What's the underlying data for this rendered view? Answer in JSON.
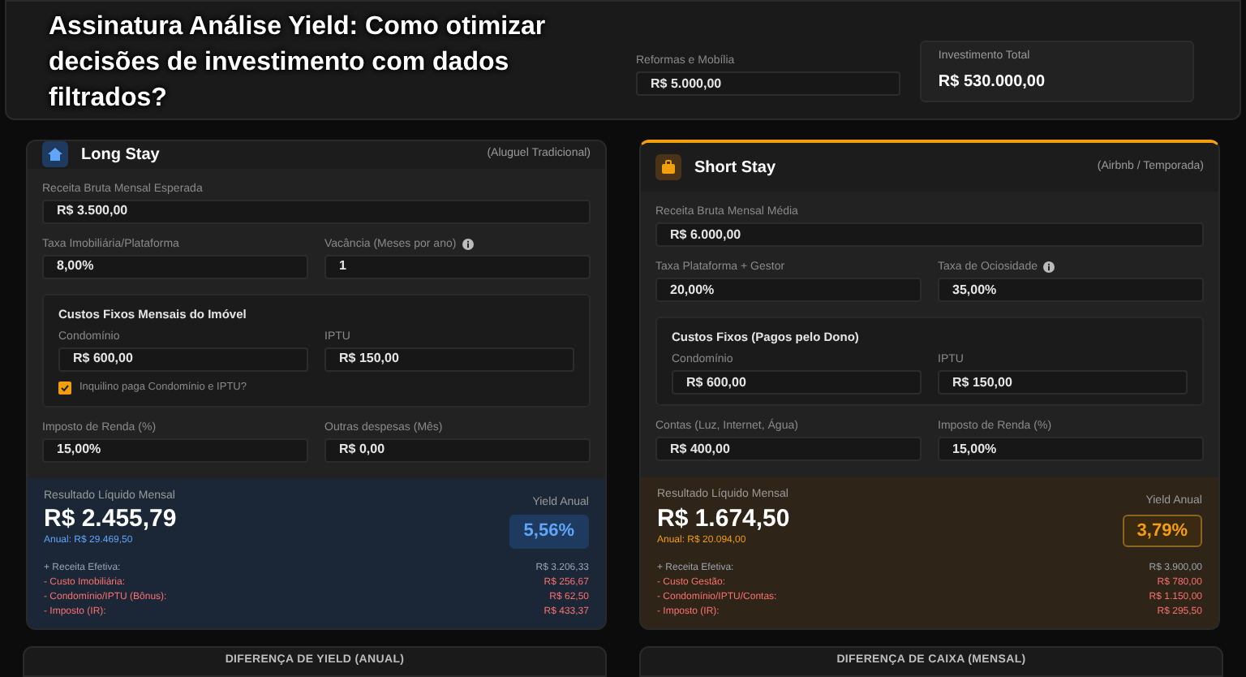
{
  "overlay_title": "Assinatura Análise Yield: Como otimizar decisões de investimento com dados filtrados?",
  "investment": {
    "fields": [
      {
        "label": "Reformas e Mobília",
        "value": "R$ 5.000,00"
      }
    ],
    "total": {
      "label": "Investimento Total",
      "value": "R$ 530.000,00"
    }
  },
  "scenarios": [
    {
      "kind": "long",
      "title": "Long Stay",
      "subtitle": "(Aluguel Tradicional)",
      "revenue": {
        "label": "Receita Bruta Mensal Esperada",
        "value": "R$ 3.500,00"
      },
      "row1": [
        {
          "label": "Taxa Imobiliária/Plataforma",
          "value": "8,00%",
          "info": false
        },
        {
          "label": "Vacância (Meses por ano)",
          "value": "1",
          "info": true
        }
      ],
      "fixed": {
        "title": "Custos Fixos Mensais do Imóvel",
        "fields": [
          {
            "label": "Condomínio",
            "value": "R$ 600,00"
          },
          {
            "label": "IPTU",
            "value": "R$ 150,00"
          }
        ],
        "checkbox": {
          "label": "Inquilino paga Condomínio e IPTU?",
          "checked": true
        }
      },
      "row2": [
        {
          "label": "Imposto de Renda (%)",
          "value": "15,00%",
          "info": false
        },
        {
          "label": "Outras despesas (Mês)",
          "value": "R$ 0,00",
          "info": false
        }
      ],
      "result": {
        "label": "Resultado Líquido Mensal",
        "value": "R$ 2.455,79",
        "annual": "Anual: R$ 29.469,50",
        "yield_label": "Yield Anual",
        "yield": "5,56%"
      },
      "breakdown": [
        {
          "label": "+ Receita Efetiva:",
          "value": "R$ 3.206,33",
          "color": "#9ca3af"
        },
        {
          "label": "- Custo Imobiliária:",
          "value": "R$ 256,67",
          "color": "#f87171"
        },
        {
          "label": "- Condomínio/IPTU (Bônus):",
          "value": "R$ 62,50",
          "color": "#f87171"
        },
        {
          "label": "- Imposto (IR):",
          "value": "R$ 433,37",
          "color": "#f87171"
        }
      ]
    },
    {
      "kind": "short",
      "title": "Short Stay",
      "subtitle": "(Airbnb / Temporada)",
      "revenue": {
        "label": "Receita Bruta Mensal Média",
        "value": "R$ 6.000,00"
      },
      "row1": [
        {
          "label": "Taxa Plataforma + Gestor",
          "value": "20,00%",
          "info": false
        },
        {
          "label": "Taxa de Ociosidade",
          "value": "35,00%",
          "info": true
        }
      ],
      "fixed": {
        "title": "Custos Fixos (Pagos pelo Dono)",
        "fields": [
          {
            "label": "Condomínio",
            "value": "R$ 600,00"
          },
          {
            "label": "IPTU",
            "value": "R$ 150,00"
          }
        ]
      },
      "row2": [
        {
          "label": "Contas (Luz, Internet, Água)",
          "value": "R$ 400,00",
          "info": false
        },
        {
          "label": "Imposto de Renda (%)",
          "value": "15,00%",
          "info": false
        }
      ],
      "result": {
        "label": "Resultado Líquido Mensal",
        "value": "R$ 1.674,50",
        "annual": "Anual: R$ 20.094,00",
        "yield_label": "Yield Anual",
        "yield": "3,79%"
      },
      "breakdown": [
        {
          "label": "+ Receita Efetiva:",
          "value": "R$ 3.900,00",
          "color": "#9ca3af"
        },
        {
          "label": "- Custo Gestão:",
          "value": "R$ 780,00",
          "color": "#f87171"
        },
        {
          "label": "- Condomínio/IPTU/Contas:",
          "value": "R$ 1.150,00",
          "color": "#f87171"
        },
        {
          "label": "- Imposto (IR):",
          "value": "R$ 295,50",
          "color": "#f87171"
        }
      ]
    }
  ],
  "comparison": [
    {
      "title": "DIFERENÇA DE YIELD (ANUAL)"
    },
    {
      "title": "DIFERENÇA DE CAIXA (MENSAL)"
    }
  ]
}
